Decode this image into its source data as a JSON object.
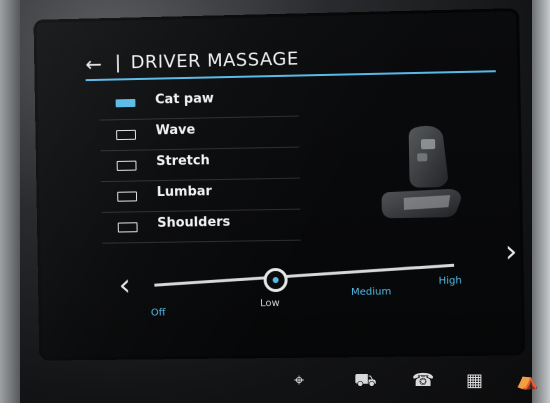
{
  "header": {
    "back_glyph": "←",
    "title": "DRIVER MASSAGE"
  },
  "massage_programs": {
    "items": [
      {
        "label": "Cat paw",
        "active": true
      },
      {
        "label": "Wave",
        "active": false
      },
      {
        "label": "Stretch",
        "active": false
      },
      {
        "label": "Lumbar",
        "active": false
      },
      {
        "label": "Shoulders",
        "active": false
      }
    ]
  },
  "intensity": {
    "levels": [
      "Off",
      "Low",
      "Medium",
      "High"
    ],
    "selected": "Low",
    "prev_glyph": "‹",
    "next_glyph": "›"
  },
  "bottom_bar": {
    "icons": [
      "nav-icon",
      "car-icon",
      "phone-icon",
      "apps-icon",
      "seat-icon"
    ]
  },
  "colors": {
    "accent": "#58b9e6",
    "text": "#f2f2f2",
    "background": "#060708"
  }
}
